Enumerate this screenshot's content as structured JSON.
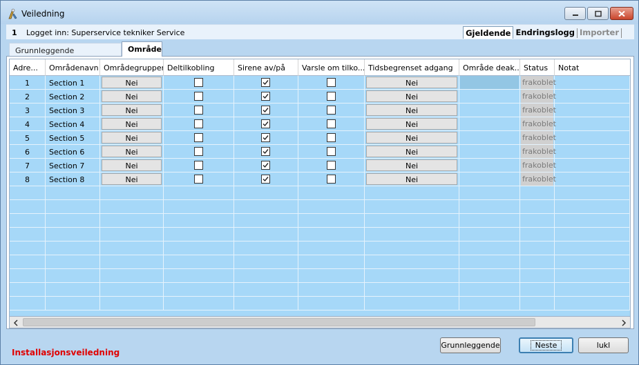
{
  "window": {
    "title": "Veiledning",
    "title_icon": "wizard-icon"
  },
  "info": {
    "number": "1",
    "logged_in": "Logget inn: Superservice tekniker Service",
    "tabs": [
      {
        "label": "Gjeldende",
        "active": true
      },
      {
        "label": "Endringslogg",
        "active": false
      },
      {
        "label": "Importer",
        "active": false,
        "disabled": true
      }
    ]
  },
  "page_tabs": [
    {
      "label": "Grunnleggende innstillinger"
    },
    {
      "label": "Område"
    }
  ],
  "table": {
    "columns": [
      "Adre...",
      "Områdenavn",
      "Områdegrupper",
      "Deltilkobling",
      "Sirene av/på",
      "Varsle om tilko...",
      "Tidsbegrenset adgang",
      "Område deak...",
      "Status",
      "Notat"
    ],
    "rows": [
      {
        "adr": "1",
        "name": "Section 1",
        "groups": "Nei",
        "delt": false,
        "sirene": true,
        "varsle": false,
        "tids": "Nei",
        "status": "frakoblet"
      },
      {
        "adr": "2",
        "name": "Section 2",
        "groups": "Nei",
        "delt": false,
        "sirene": true,
        "varsle": false,
        "tids": "Nei",
        "status": "frakoblet"
      },
      {
        "adr": "3",
        "name": "Section 3",
        "groups": "Nei",
        "delt": false,
        "sirene": true,
        "varsle": false,
        "tids": "Nei",
        "status": "frakoblet"
      },
      {
        "adr": "4",
        "name": "Section 4",
        "groups": "Nei",
        "delt": false,
        "sirene": true,
        "varsle": false,
        "tids": "Nei",
        "status": "frakoblet"
      },
      {
        "adr": "5",
        "name": "Section 5",
        "groups": "Nei",
        "delt": false,
        "sirene": true,
        "varsle": false,
        "tids": "Nei",
        "status": "frakoblet"
      },
      {
        "adr": "6",
        "name": "Section 6",
        "groups": "Nei",
        "delt": false,
        "sirene": true,
        "varsle": false,
        "tids": "Nei",
        "status": "frakoblet"
      },
      {
        "adr": "7",
        "name": "Section 7",
        "groups": "Nei",
        "delt": false,
        "sirene": true,
        "varsle": false,
        "tids": "Nei",
        "status": "frakoblet"
      },
      {
        "adr": "8",
        "name": "Section 8",
        "groups": "Nei",
        "delt": false,
        "sirene": true,
        "varsle": false,
        "tids": "Nei",
        "status": "frakoblet"
      }
    ]
  },
  "footer": {
    "title": "Installasjonsveiledning",
    "buttons": {
      "basic": "Grunnleggende",
      "next": "Neste",
      "close": "lukl"
    }
  },
  "colors": {
    "grid_bg": "#a6d8f8",
    "footer_title": "#e00000"
  }
}
